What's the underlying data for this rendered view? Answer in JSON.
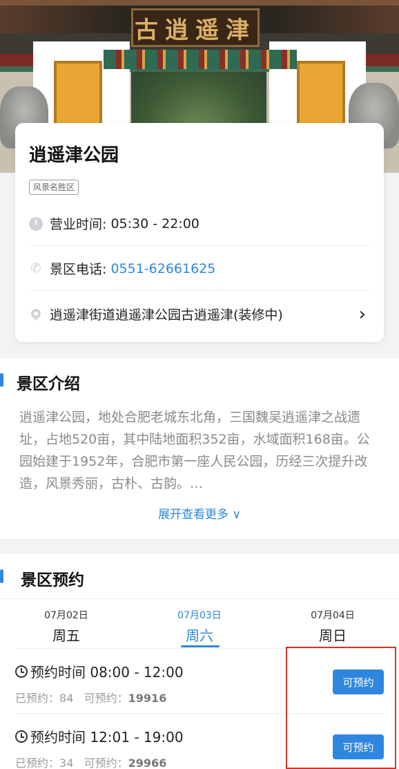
{
  "hero": {
    "plaque_text": "古逍遥津"
  },
  "park": {
    "name": "逍遥津公园",
    "tag": "风景名胜区",
    "hours_label": "营业时间:",
    "hours_value": "05:30 - 22:00",
    "phone_label": "景区电话:",
    "phone_value": "0551-62661625",
    "address": "逍遥津街道逍遥津公园古逍遥津(装修中)",
    "address_chevron": "›"
  },
  "intro": {
    "title": "景区介绍",
    "text": "逍遥津公园，地处合肥老城东北角，三国魏吴逍遥津之战遗址，占地520亩，其中陆地面积352亩，水域面积168亩。公园始建于1952年，合肥市第一座人民公园，历经三次提升改造，风景秀丽，古朴、古韵。…",
    "expand_label": "展开查看更多 ∨"
  },
  "booking": {
    "title": "景区预约",
    "days": [
      {
        "date": "07月02日",
        "week": "周五",
        "active": false
      },
      {
        "date": "07月03日",
        "week": "周六",
        "active": true
      },
      {
        "date": "07月04日",
        "week": "周日",
        "active": false
      }
    ],
    "slots": [
      {
        "time_label": "预约时间 08:00 - 12:00",
        "booked_label": "已预约：",
        "booked": "84",
        "available_label": "可预约：",
        "available": "19916",
        "button": "可预约"
      },
      {
        "time_label": "预约时间 12:01 - 19:00",
        "booked_label": "已预约：",
        "booked": "34",
        "available_label": "可预约：",
        "available": "29966",
        "button": "可预约"
      }
    ]
  },
  "colors": {
    "accent": "#2e86de",
    "highlight_box": "#d93025"
  }
}
